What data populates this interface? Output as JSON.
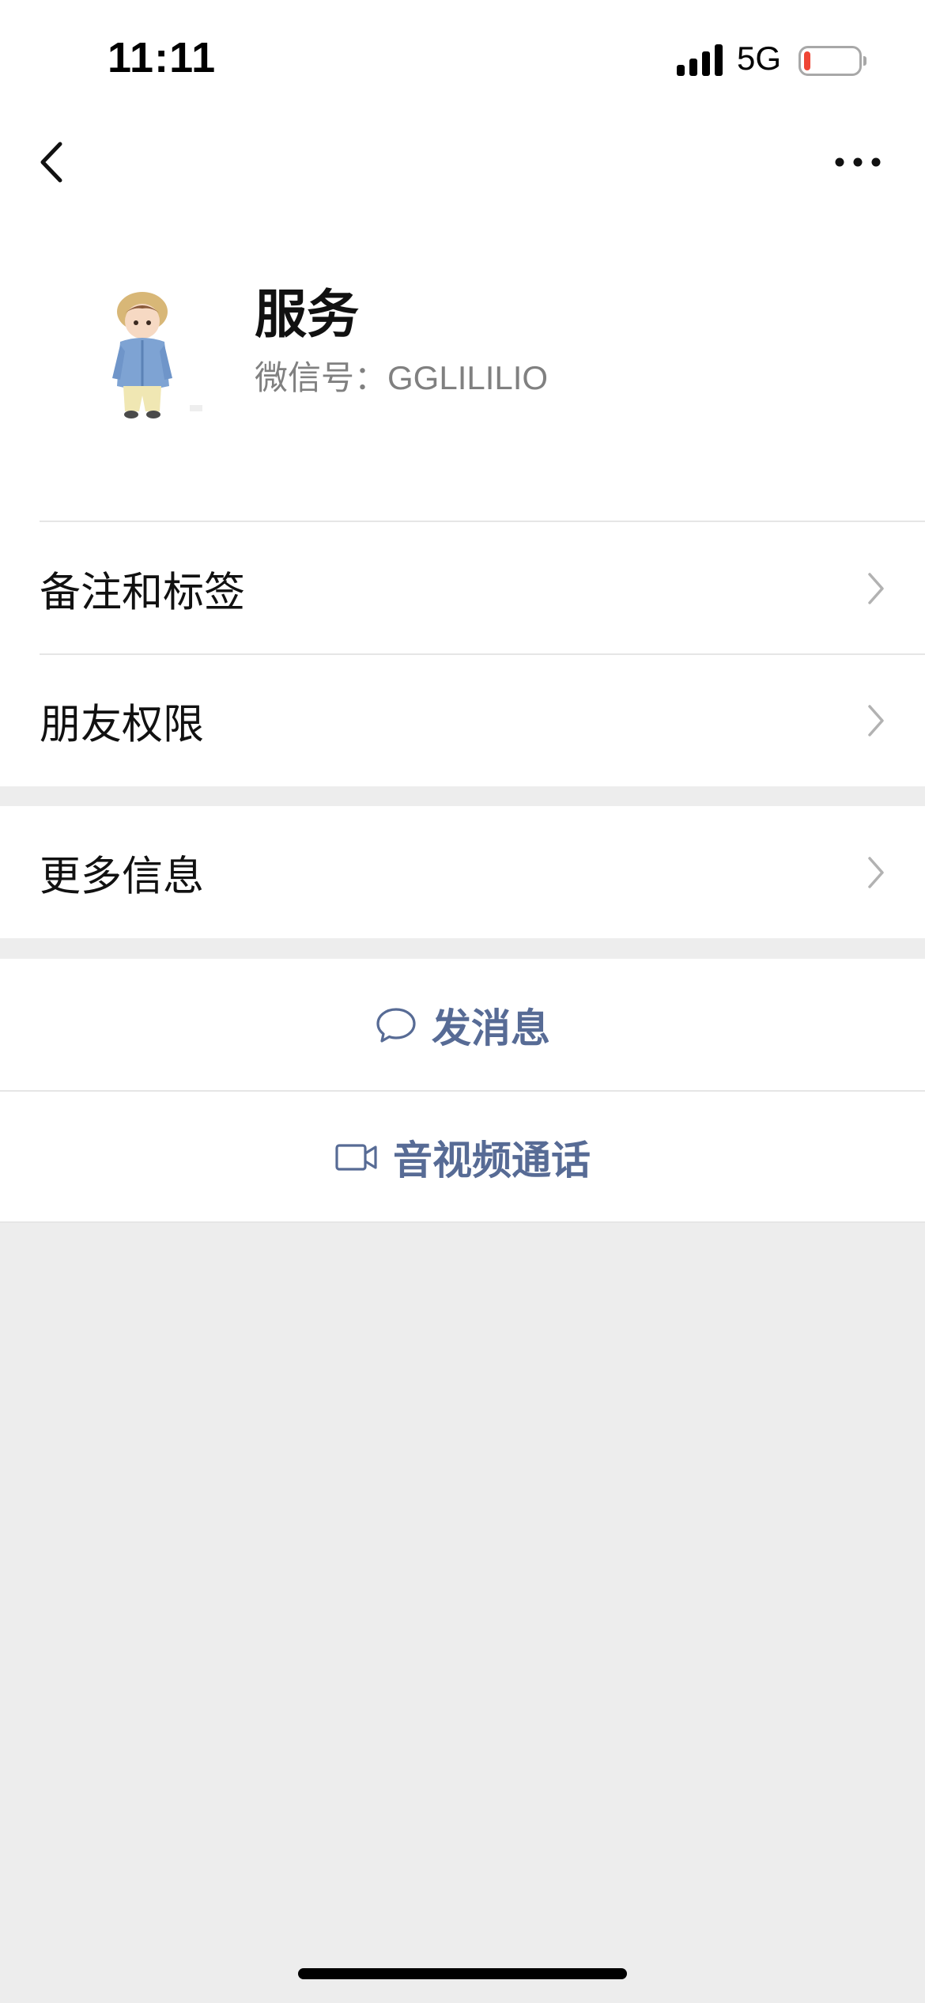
{
  "status_bar": {
    "time": "11:11",
    "network": "5G",
    "battery_level": 0.12,
    "battery_color": "#ef4535"
  },
  "nav": {
    "back_icon": "chevron-left-icon",
    "more_icon": "ellipsis-icon"
  },
  "profile": {
    "name": "服务",
    "wechat_id": "微信号：GGLILILIO",
    "avatar": "cartoon-boy-avatar"
  },
  "settings_group": {
    "items": [
      {
        "label": "备注和标签"
      },
      {
        "label": "朋友权限"
      }
    ]
  },
  "info_group": {
    "items": [
      {
        "label": "更多信息"
      }
    ]
  },
  "actions": {
    "send_message": {
      "label": "发消息",
      "icon": "chat-bubble-icon"
    },
    "video_call": {
      "label": "音视频通话",
      "icon": "video-camera-icon"
    }
  },
  "colors": {
    "link": "#576b95",
    "background": "#ededed"
  }
}
